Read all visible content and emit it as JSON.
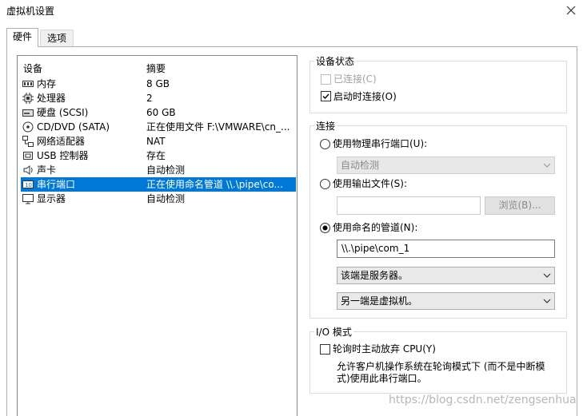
{
  "window": {
    "title": "虚拟机设置",
    "close_icon": "close-icon"
  },
  "tabs": [
    {
      "label": "硬件",
      "active": true
    },
    {
      "label": "选项",
      "active": false
    }
  ],
  "device_list": {
    "headers": {
      "device": "设备",
      "summary": "摘要"
    },
    "items": [
      {
        "name": "内存",
        "summary": "8 GB",
        "icon": "memory-icon"
      },
      {
        "name": "处理器",
        "summary": "2",
        "icon": "cpu-icon"
      },
      {
        "name": "硬盘 (SCSI)",
        "summary": "60 GB",
        "icon": "harddisk-icon"
      },
      {
        "name": "CD/DVD (SATA)",
        "summary": "正在使用文件 F:\\VMWARE\\cn_...",
        "icon": "cd-icon"
      },
      {
        "name": "网络适配器",
        "summary": "NAT",
        "icon": "network-icon"
      },
      {
        "name": "USB 控制器",
        "summary": "存在",
        "icon": "usb-icon"
      },
      {
        "name": "声卡",
        "summary": "自动检测",
        "icon": "sound-icon"
      },
      {
        "name": "串行端口",
        "summary": "正在使用命名管道 \\\\.\\pipe\\co...",
        "icon": "serial-port-icon",
        "selected": true
      },
      {
        "name": "显示器",
        "summary": "自动检测",
        "icon": "display-icon"
      }
    ]
  },
  "device_status": {
    "title": "设备状态",
    "connected": {
      "label": "已连接(C)",
      "checked": false,
      "disabled": true
    },
    "connect_at_power_on": {
      "label": "启动时连接(O)",
      "checked": true
    }
  },
  "connection": {
    "title": "连接",
    "physical_port": {
      "label": "使用物理串行端口(U):",
      "selected": false,
      "select_value": "自动检测"
    },
    "output_file": {
      "label": "使用输出文件(S):",
      "selected": false,
      "input_value": "",
      "browse_label": "浏览(B)..."
    },
    "named_pipe": {
      "label": "使用命名的管道(N):",
      "selected": true,
      "pipe_value": "\\\\.\\pipe\\com_1",
      "end_select": "该端是服务器。",
      "other_end_select": "另一端是虚拟机。"
    }
  },
  "io_mode": {
    "title": "I/O 模式",
    "yield_cpu": {
      "label": "轮询时主动放弃 CPU(Y)",
      "checked": false
    },
    "description_line1": "允许客户机操作系统在轮询模式下 (而不是中断模",
    "description_line2": "式)使用此串行端口。"
  },
  "watermark": "https://blog.csdn.net/zengsenhua"
}
